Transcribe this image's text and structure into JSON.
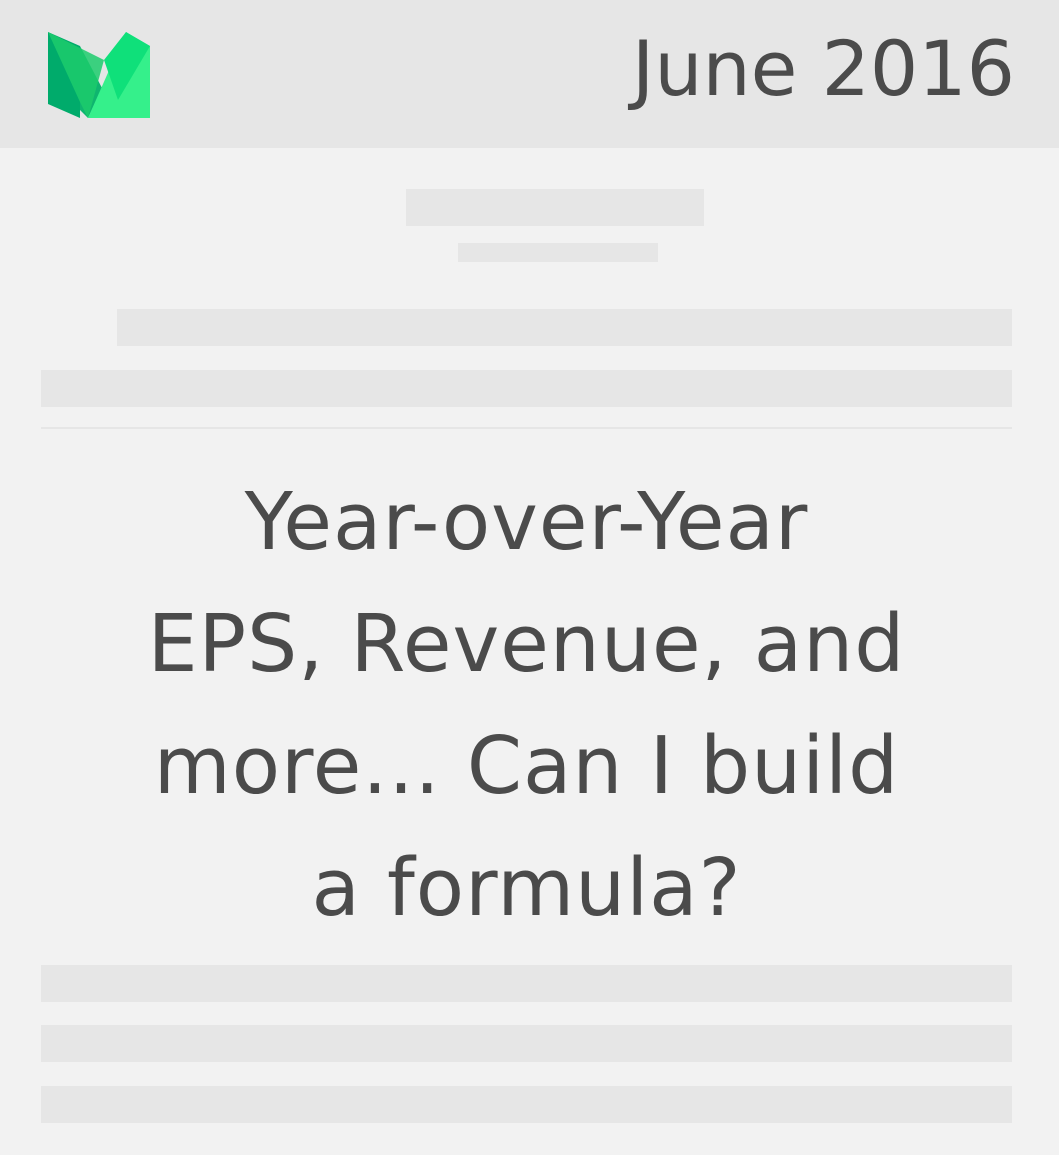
{
  "header": {
    "logo": "medium-logo",
    "date": "June 2016",
    "brand_colors": {
      "dark": "#00ab6b",
      "mid": "#1ccb6c",
      "light": "#35f08b"
    }
  },
  "article": {
    "title_lines": [
      "Year-over-Year",
      "EPS, Revenue, and",
      "more... Can I build",
      "a formula?"
    ]
  },
  "colors": {
    "background": "#f2f2f2",
    "placeholder": "#e6e6e6",
    "text": "#4b4b4b"
  }
}
